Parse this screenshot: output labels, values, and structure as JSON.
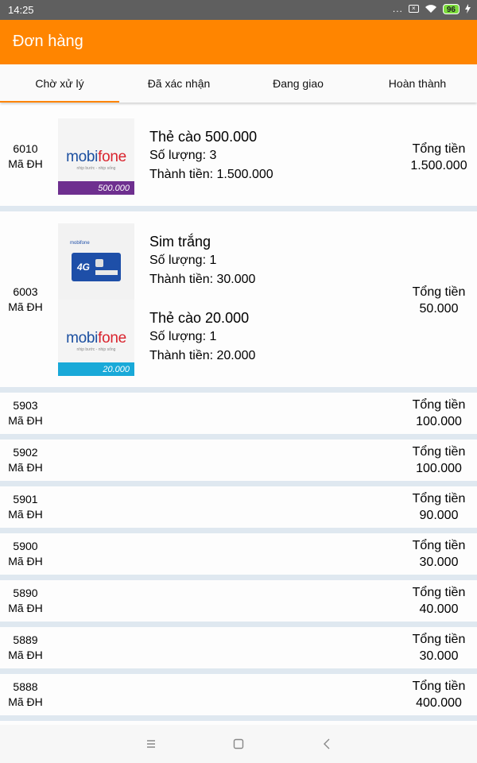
{
  "status_bar": {
    "time": "14:25",
    "dots": "...",
    "battery": "96"
  },
  "app_bar": {
    "title": "Đơn hàng"
  },
  "tabs": [
    "Chờ xử lý",
    "Đã xác nhận",
    "Đang giao",
    "Hoàn thành"
  ],
  "active_tab": 0,
  "labels": {
    "order_id": "Mã ĐH",
    "total": "Tổng tiền"
  },
  "orders": [
    {
      "id": "6010",
      "total": "1.500.000",
      "items": [
        {
          "name": "Thẻ cào 500.000",
          "quantity": "Số lượng: 3",
          "subtotal": "Thành tiền: 1.500.000",
          "image": {
            "brand_a": "mobi",
            "brand_b": "fone",
            "tagline": "nhịp bước - nhịp sống",
            "value": "500.000",
            "band_color": "#6e2f8f"
          }
        }
      ]
    },
    {
      "id": "6003",
      "total": "50.000",
      "items": [
        {
          "name": "Sim trắng",
          "quantity": "Số lượng: 1",
          "subtotal": "Thành tiền: 30.000",
          "image": {
            "brand": "mobifone",
            "badge": "4G"
          }
        },
        {
          "name": "Thẻ cào 20.000",
          "quantity": "Số lượng: 1",
          "subtotal": "Thành tiền: 20.000",
          "image": {
            "brand_a": "mobi",
            "brand_b": "fone",
            "tagline": "nhịp bước - nhịp sống",
            "value": "20.000",
            "band_color": "#19a9d8"
          }
        }
      ]
    },
    {
      "id": "5903",
      "total": "100.000"
    },
    {
      "id": "5902",
      "total": "100.000"
    },
    {
      "id": "5901",
      "total": "90.000"
    },
    {
      "id": "5900",
      "total": "30.000"
    },
    {
      "id": "5890",
      "total": "40.000"
    },
    {
      "id": "5889",
      "total": "30.000"
    },
    {
      "id": "5888",
      "total": "400.000"
    }
  ]
}
